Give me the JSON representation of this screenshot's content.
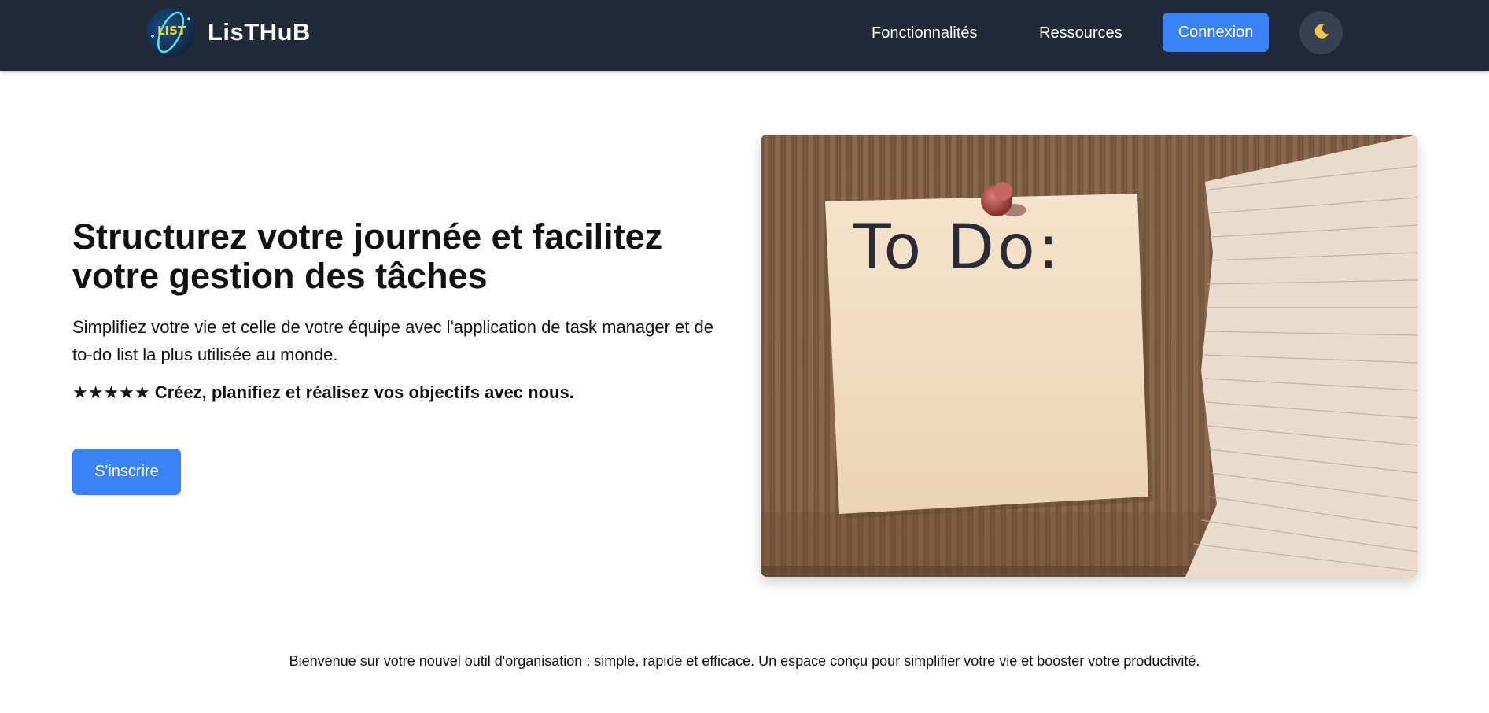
{
  "brand": {
    "name": "LisTHuB",
    "logo_text": "LIST"
  },
  "nav": {
    "features": "Fonctionnalités",
    "resources": "Ressources",
    "login": "Connexion",
    "theme_icon": "moon-icon"
  },
  "hero": {
    "title_line1": "Structurez votre journée et facilitez",
    "title_line2": "votre gestion des tâches",
    "subtitle_line1": "Simplifiez votre vie et celle de votre équipe avec l'application de task manager et de",
    "subtitle_line2": "to-do list la plus utilisée au monde.",
    "tagline": "★★★★★ Créez, planifiez et réalisez vos objectifs avec nous.",
    "signup": "S'inscrire",
    "image_text": "To Do:"
  },
  "footer": {
    "text": "Bienvenue sur votre nouvel outil d'organisation : simple, rapide et efficace. Un espace conçu pour simplifier votre vie et booster votre productivité."
  },
  "colors": {
    "navbar": "#1f2937",
    "accent": "#3b82f6",
    "toggle": "#374151"
  }
}
